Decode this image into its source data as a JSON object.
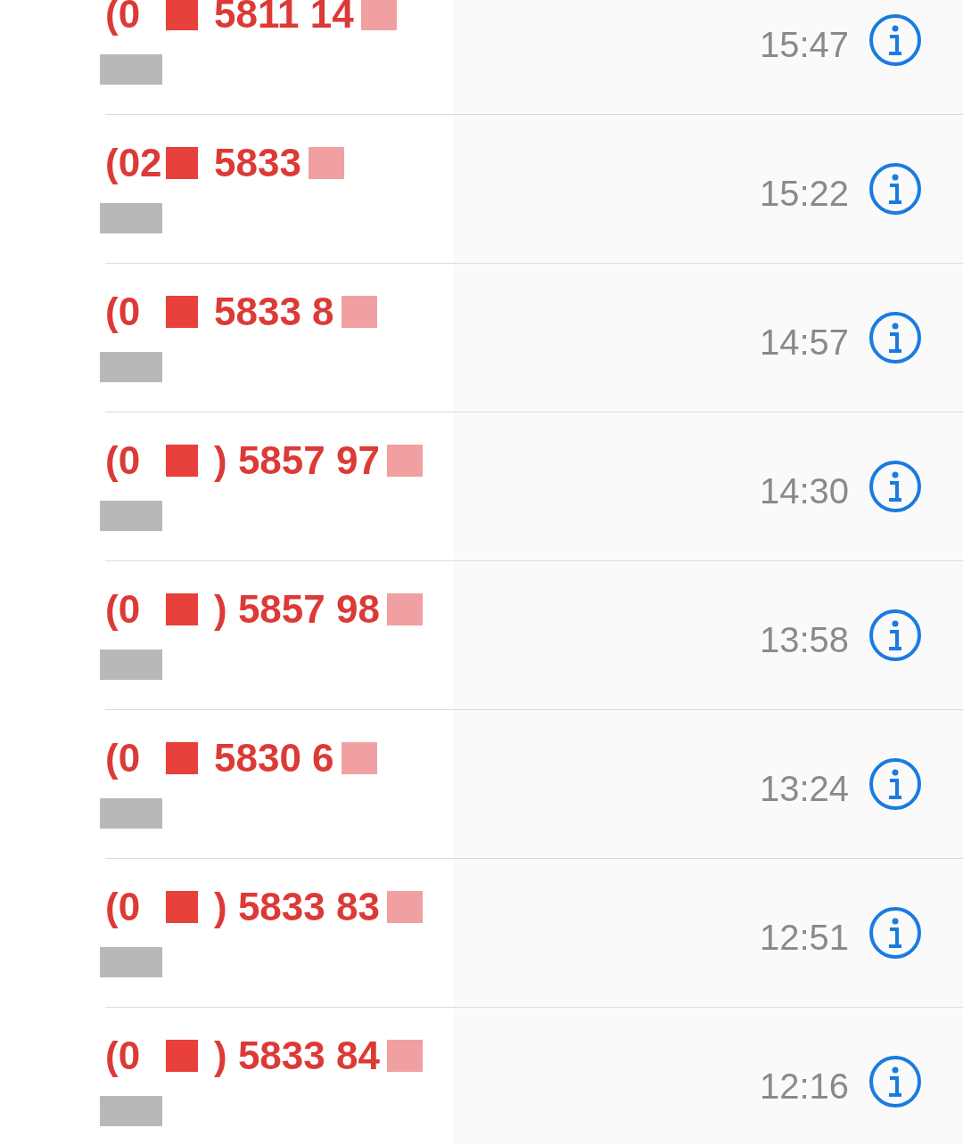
{
  "calls": [
    {
      "area": "(0",
      "number": "5811 14",
      "time": "15:47"
    },
    {
      "area": "(02",
      "number": "5833",
      "time": "15:22"
    },
    {
      "area": "(0",
      "number": "5833 8",
      "time": "14:57"
    },
    {
      "area": "(0",
      "number": ") 5857 97",
      "time": "14:30"
    },
    {
      "area": "(0",
      "number": ") 5857 98",
      "time": "13:58"
    },
    {
      "area": "(0",
      "number": "5830 6",
      "time": "13:24"
    },
    {
      "area": "(0",
      "number": ") 5833 83",
      "time": "12:51"
    },
    {
      "area": "(0",
      "number": ") 5833 84",
      "time": "12:16"
    }
  ]
}
